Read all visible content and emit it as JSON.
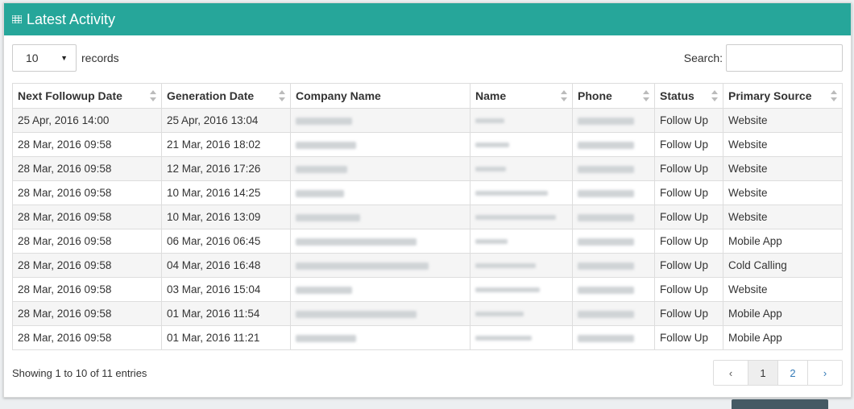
{
  "header": {
    "title": "Latest Activity",
    "icon": "table-icon"
  },
  "length": {
    "value": "10",
    "label": "records"
  },
  "search": {
    "label": "Search:",
    "value": "",
    "placeholder": ""
  },
  "columns": [
    "Next Followup Date",
    "Generation Date",
    "Company Name",
    "Name",
    "Phone",
    "Status",
    "Primary Source"
  ],
  "rows": [
    {
      "next": "25 Apr, 2016 14:00",
      "gen": "25 Apr, 2016 13:04",
      "status": "Follow Up",
      "source": "Website"
    },
    {
      "next": "28 Mar, 2016 09:58",
      "gen": "21 Mar, 2016 18:02",
      "status": "Follow Up",
      "source": "Website"
    },
    {
      "next": "28 Mar, 2016 09:58",
      "gen": "12 Mar, 2016 17:26",
      "status": "Follow Up",
      "source": "Website"
    },
    {
      "next": "28 Mar, 2016 09:58",
      "gen": "10 Mar, 2016 14:25",
      "status": "Follow Up",
      "source": "Website"
    },
    {
      "next": "28 Mar, 2016 09:58",
      "gen": "10 Mar, 2016 13:09",
      "status": "Follow Up",
      "source": "Website"
    },
    {
      "next": "28 Mar, 2016 09:58",
      "gen": "06 Mar, 2016 06:45",
      "status": "Follow Up",
      "source": "Mobile App"
    },
    {
      "next": "28 Mar, 2016 09:58",
      "gen": "04 Mar, 2016 16:48",
      "status": "Follow Up",
      "source": "Cold Calling"
    },
    {
      "next": "28 Mar, 2016 09:58",
      "gen": "03 Mar, 2016 15:04",
      "status": "Follow Up",
      "source": "Website"
    },
    {
      "next": "28 Mar, 2016 09:58",
      "gen": "01 Mar, 2016 11:54",
      "status": "Follow Up",
      "source": "Mobile App"
    },
    {
      "next": "28 Mar, 2016 09:58",
      "gen": "01 Mar, 2016 11:21",
      "status": "Follow Up",
      "source": "Mobile App"
    }
  ],
  "footer": {
    "info": "Showing 1 to 10 of 11 entries"
  },
  "pagination": {
    "prev": "‹",
    "pages": [
      "1",
      "2"
    ],
    "next": "›",
    "active": "1"
  },
  "colors": {
    "header": "#26a69a",
    "link": "#337ab7",
    "stripe": "#f5f5f5"
  }
}
